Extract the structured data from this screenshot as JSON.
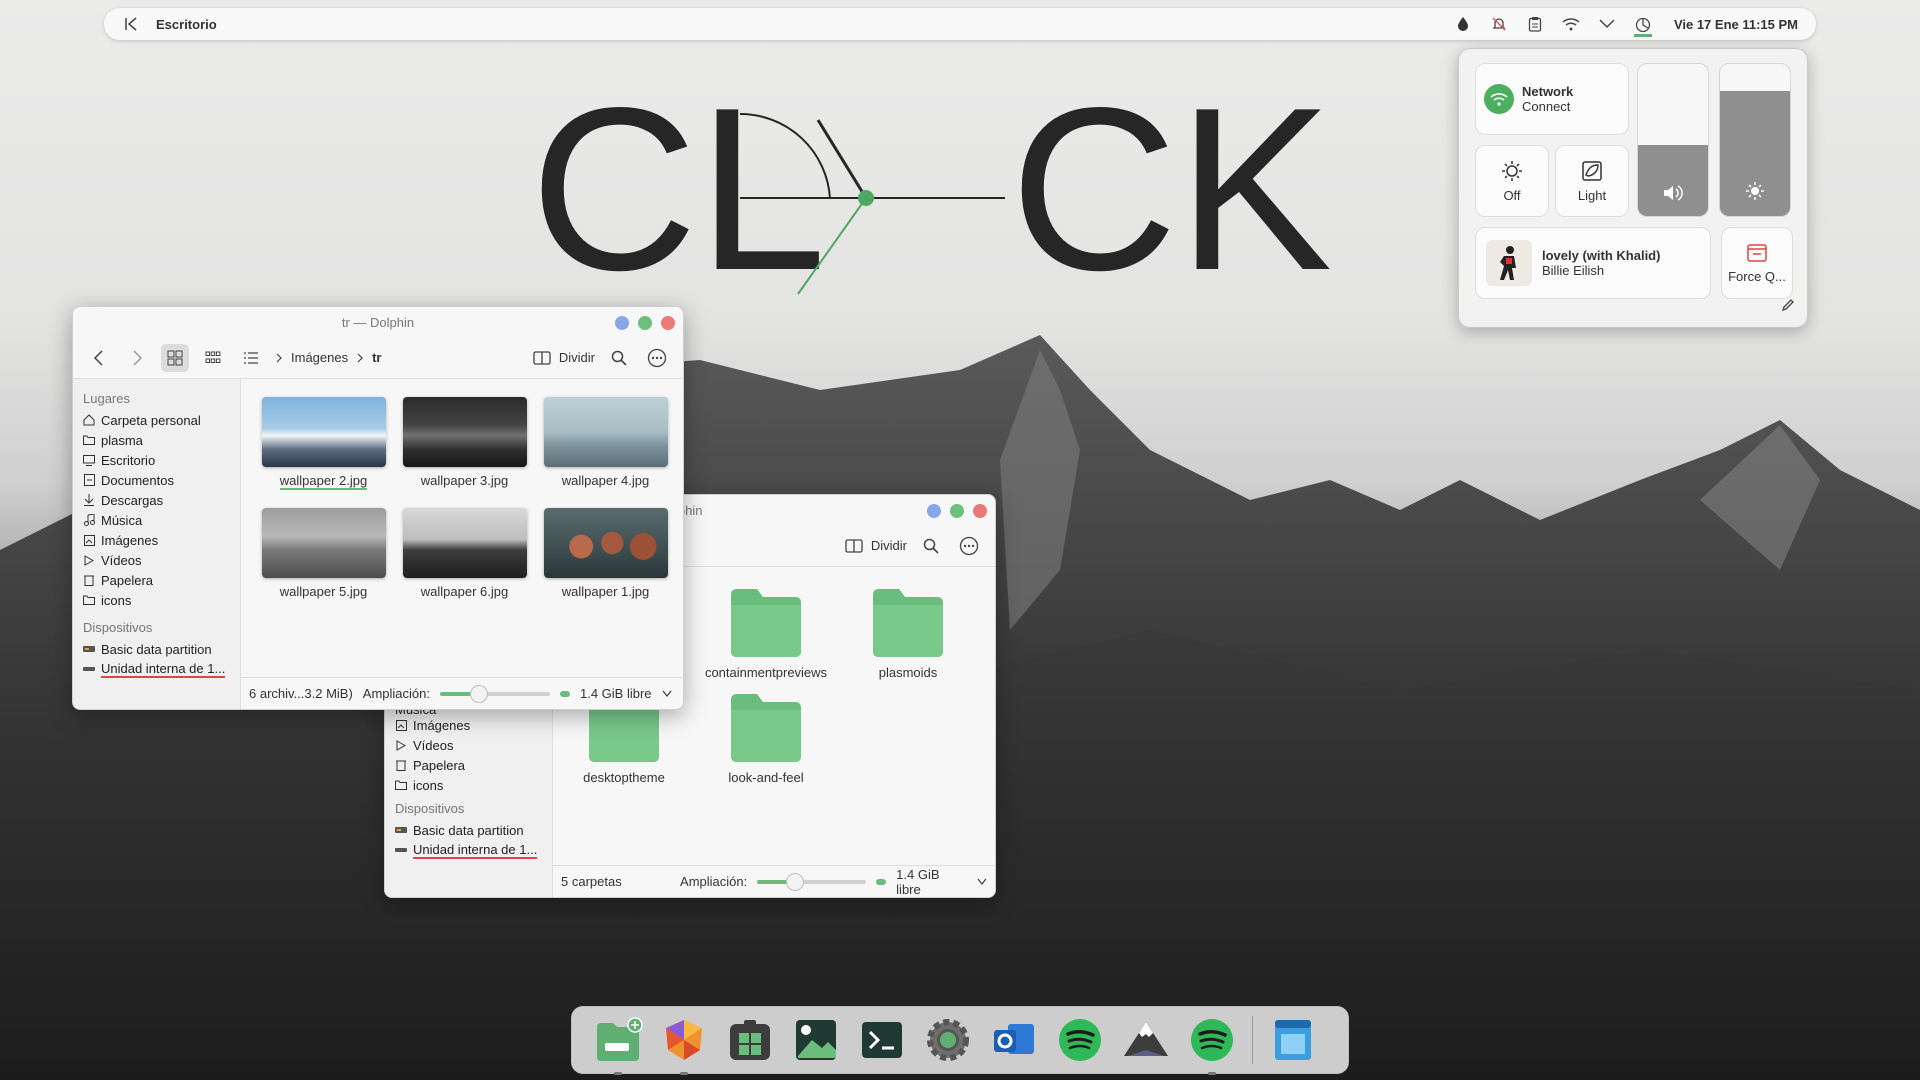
{
  "panel": {
    "title": "Escritorio",
    "datetime": "Vie 17 Ene  11:15 PM"
  },
  "clock_logo": {
    "text_left": "CL",
    "text_right": "CK"
  },
  "control_center": {
    "network": {
      "title": "Network",
      "subtitle": "Connect"
    },
    "night": {
      "label": "Off"
    },
    "theme": {
      "label": "Light"
    },
    "volume_level": 0.47,
    "brightness_level": 0.82,
    "media": {
      "title": "lovely (with Khalid)",
      "artist": "Billie Eilish"
    },
    "force_quit": {
      "label": "Force Q..."
    }
  },
  "window1": {
    "title": "tr — Dolphin",
    "breadcrumb": [
      "Imágenes",
      "tr"
    ],
    "split_label": "Dividir",
    "places_header": "Lugares",
    "places": [
      "Carpeta personal",
      "plasma",
      "Escritorio",
      "Documentos",
      "Descargas",
      "Música",
      "Imágenes",
      "Vídeos",
      "Papelera",
      "icons"
    ],
    "devices_header": "Dispositivos",
    "devices": [
      "Basic data partition",
      "Unidad interna de 1..."
    ],
    "files": [
      "wallpaper 2.jpg",
      "wallpaper 3.jpg",
      "wallpaper 4.jpg",
      "wallpaper 5.jpg",
      "wallpaper 6.jpg",
      "wallpaper 1.jpg"
    ],
    "status": "6 archiv...3.2 MiB)",
    "zoom_label": "Ampliación:",
    "zoom_level": 0.35,
    "free": "1.4 GiB libre"
  },
  "window2": {
    "title_fragment": "lphin",
    "split_label": "Dividir",
    "places_partial": [
      "Música",
      "Imágenes",
      "Vídeos",
      "Papelera",
      "icons"
    ],
    "devices_header": "Dispositivos",
    "devices": [
      "Basic data partition",
      "Unidad interna de 1..."
    ],
    "folders": [
      "containmentpreviews",
      "plasmoids",
      "desktoptheme",
      "look-and-feel"
    ],
    "status": "5 carpetas",
    "zoom_label": "Ampliación:",
    "zoom_level": 0.35,
    "free": "1.4 GiB libre"
  },
  "dock": {
    "icons": [
      "file-manager-icon",
      "firefox-icon",
      "app-grid-icon",
      "image-viewer-icon",
      "terminal-icon",
      "settings-icon",
      "outlook-icon",
      "spotify-icon",
      "mountain-app-icon",
      "spotify-icon",
      "window-manager-icon"
    ]
  },
  "colors": {
    "accent": "#5fae72",
    "folder": "#6bbd7e",
    "dark_text": "#262626"
  }
}
